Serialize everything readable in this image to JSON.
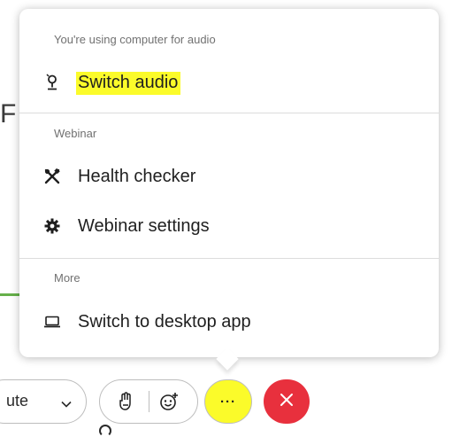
{
  "background": {
    "partial_glyph": "F"
  },
  "popup": {
    "sections": [
      {
        "header": "You're using computer for audio",
        "items": [
          {
            "label": "Switch audio",
            "icon": "speaker-switch-icon",
            "highlighted": true
          }
        ]
      },
      {
        "header": "Webinar",
        "items": [
          {
            "label": "Health checker",
            "icon": "tools-icon",
            "highlighted": false
          },
          {
            "label": "Webinar settings",
            "icon": "gear-icon",
            "highlighted": false
          }
        ]
      },
      {
        "header": "More",
        "items": [
          {
            "label": "Switch to desktop app",
            "icon": "laptop-icon",
            "highlighted": false
          }
        ]
      }
    ]
  },
  "controls": {
    "mute_label_partial": "ute",
    "mute_caret_icon": "chevron-down-icon",
    "raise_hand_icon": "raise-hand-icon",
    "reactions_icon": "add-reaction-icon",
    "more_label": "···",
    "more_highlighted": true,
    "leave_icon": "close-icon"
  },
  "colors": {
    "highlight": "#fbfb2a",
    "leave": "#e8303d",
    "section_header": "#717171",
    "accent_green": "#66b04a"
  }
}
